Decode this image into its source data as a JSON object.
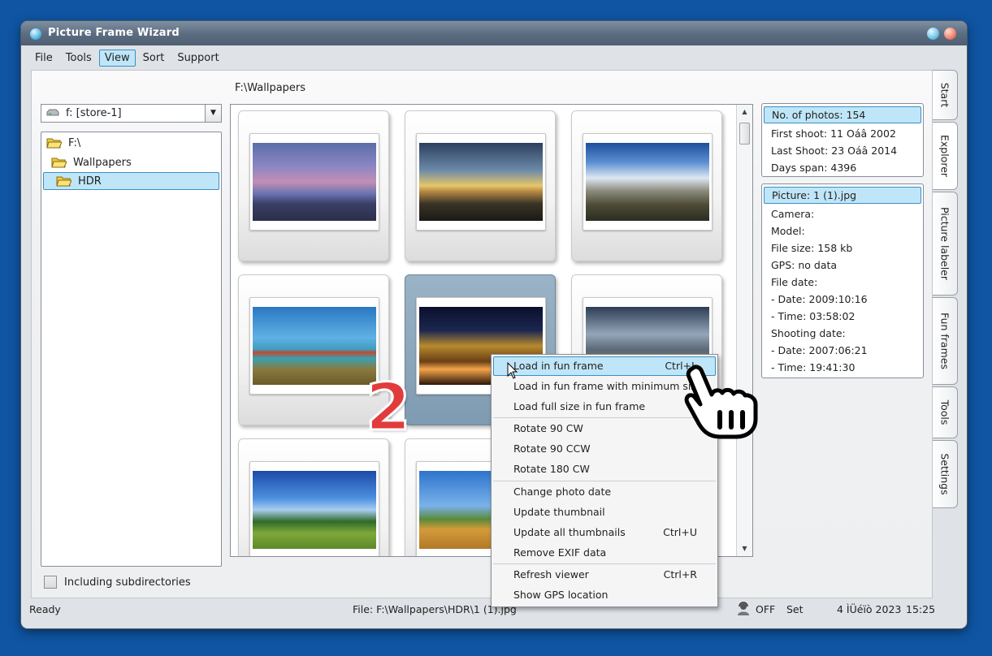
{
  "window": {
    "title": "Picture Frame Wizard"
  },
  "menu": [
    "File",
    "Tools",
    "View",
    "Sort",
    "Support"
  ],
  "active_menu": "View",
  "explorer": {
    "path": "F:\\Wallpapers",
    "drive": "f: [store-1]",
    "tree": [
      "F:\\",
      "Wallpapers",
      "HDR"
    ],
    "selected_folder": "HDR",
    "include_subdirs_label": "Including subdirectories",
    "include_subdirs_checked": false
  },
  "thumbnails": {
    "count_visible": 8,
    "selected_index": 4
  },
  "stats": {
    "header": "No. of photos: 154",
    "lines": [
      "First shoot: 11 Oáâ 2002",
      "Last Shoot: 23 Oáâ 2014",
      "Days span: 4396"
    ]
  },
  "picture_info": {
    "header": "Picture: 1 (1).jpg",
    "lines": [
      "Camera:",
      "Model:",
      "File size: 158 kb",
      "GPS: no data",
      "File date:",
      "- Date: 2009:10:16",
      "- Time: 03:58:02",
      "Shooting date:",
      "- Date: 2007:06:21",
      "- Time: 19:41:30"
    ]
  },
  "side_tabs": [
    "Start",
    "Explorer",
    "Picture labeler",
    "Fun frames",
    "Tools",
    "Settings"
  ],
  "active_tab": "Explorer",
  "context_menu": {
    "items": [
      {
        "label": "Load in fun frame",
        "shortcut": "Ctrl+L",
        "highlighted": true
      },
      {
        "label": "Load in fun frame with minimum size",
        "shortcut": ""
      },
      {
        "label": "Load full size in fun frame",
        "shortcut": ""
      },
      {
        "label": "Rotate 90 CW",
        "shortcut": ""
      },
      {
        "label": "Rotate 90 CCW",
        "shortcut": ""
      },
      {
        "label": "Rotate 180 CW",
        "shortcut": ""
      },
      {
        "label": "Change photo date",
        "shortcut": ""
      },
      {
        "label": "Update thumbnail",
        "shortcut": ""
      },
      {
        "label": "Update all thumbnails",
        "shortcut": "Ctrl+U"
      },
      {
        "label": "Remove EXIF data",
        "shortcut": ""
      },
      {
        "label": "Refresh viewer",
        "shortcut": "Ctrl+R"
      },
      {
        "label": "Show GPS location",
        "shortcut": ""
      }
    ]
  },
  "statusbar": {
    "status": "Ready",
    "file": "File: F:\\Wallpapers\\HDR\\1 (1).jpg",
    "off": "OFF",
    "set": "Set",
    "date": "4 ÌÜéïò 2023",
    "time": "15:25"
  },
  "annotation": {
    "step_number": "2"
  },
  "colors": {
    "desktop": "#0f55a3",
    "highlight": "#bfe6f8",
    "highlight_border": "#3b8fc4",
    "selected_card": "#8aa6bb",
    "step_number": "#e23b3b"
  },
  "icons": [
    "drive-icon",
    "folder-icon",
    "scroll-up-icon",
    "scroll-down-icon",
    "avatar-icon",
    "mouse-cursor-icon",
    "pointing-hand-icon"
  ]
}
